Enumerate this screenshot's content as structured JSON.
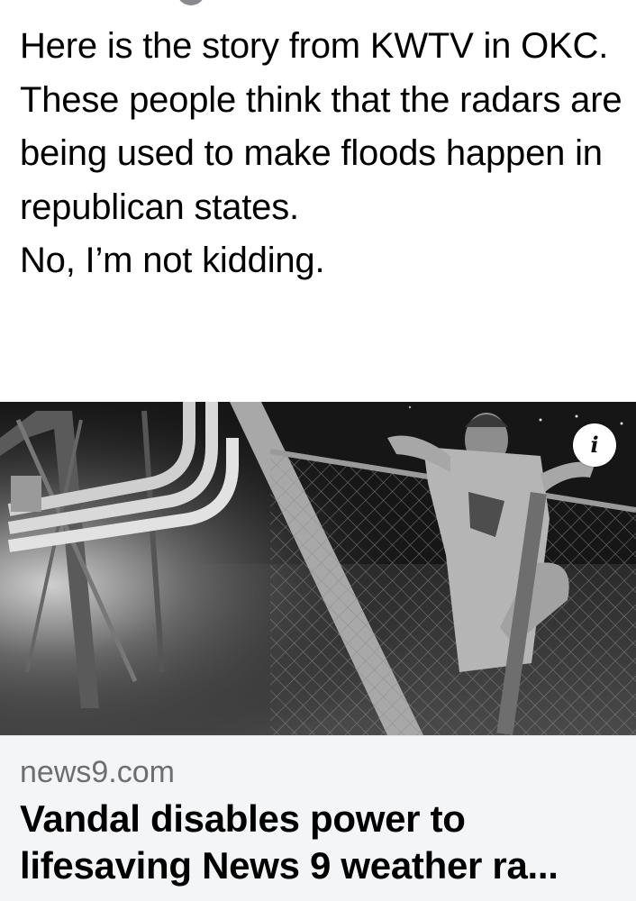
{
  "post": {
    "lines": [
      "Here is the story from KWTV in OKC.",
      "These people think that the radars are being used to make floods happen in republican states.",
      "No, I’m not kidding."
    ]
  },
  "media": {
    "info_label": "i",
    "icon": "info-icon"
  },
  "link_card": {
    "domain": "news9.com",
    "headline_line1": "Vandal disables power to",
    "headline_line2": "lifesaving News 9 weather ra..."
  }
}
